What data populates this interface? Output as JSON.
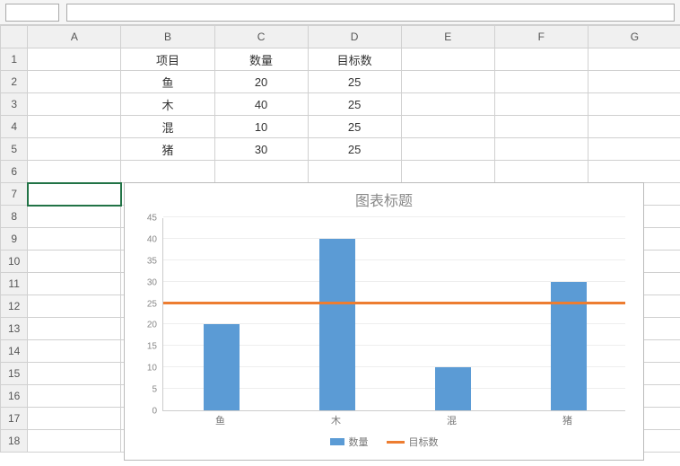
{
  "formula_bar": {
    "name_box": ""
  },
  "columns": [
    "A",
    "B",
    "C",
    "D",
    "E",
    "F",
    "G"
  ],
  "row_count": 18,
  "table": {
    "headers": {
      "B1": "项目",
      "C1": "数量",
      "D1": "目标数"
    },
    "rows": [
      {
        "B": "鱼",
        "C": "20",
        "D": "25"
      },
      {
        "B": "木",
        "C": "40",
        "D": "25"
      },
      {
        "B": "混",
        "C": "10",
        "D": "25"
      },
      {
        "B": "猪",
        "C": "30",
        "D": "25"
      }
    ]
  },
  "selected_cell": "A7",
  "chart_data": {
    "type": "bar",
    "title": "图表标题",
    "categories": [
      "鱼",
      "木",
      "混",
      "猪"
    ],
    "series": [
      {
        "name": "数量",
        "type": "bar",
        "color": "#5b9bd5",
        "values": [
          20,
          40,
          10,
          30
        ]
      },
      {
        "name": "目标数",
        "type": "line",
        "color": "#ed7d31",
        "values": [
          25,
          25,
          25,
          25
        ]
      }
    ],
    "ylim": [
      0,
      45
    ],
    "yticks": [
      0,
      5,
      10,
      15,
      20,
      25,
      30,
      35,
      40,
      45
    ],
    "xlabel": "",
    "ylabel": ""
  }
}
